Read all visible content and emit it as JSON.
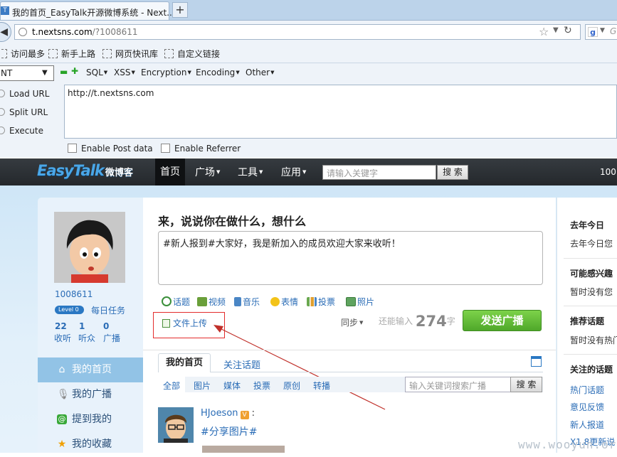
{
  "browser": {
    "tab_title": "我的首页_EasyTalk开源微博系统 - Next...",
    "new_tab_symbol": "+",
    "url_host": "t.nextsns.com",
    "url_rest": "/?1008611",
    "search_engine_hint": "G",
    "bookmarks": [
      "访问最多",
      "新手上路",
      "网页快讯库",
      "自定义链接"
    ]
  },
  "hackbar": {
    "select_value": "NT",
    "menus": [
      "SQL",
      "XSS",
      "Encryption",
      "Encoding",
      "Other"
    ],
    "actions": [
      "Load URL",
      "Split URL",
      "Execute"
    ],
    "url_value": "http://t.nextsns.com",
    "checkboxes": [
      "Enable Post data",
      "Enable Referrer"
    ]
  },
  "site": {
    "logo": "EasyTalk",
    "logo_sub": "微博客",
    "nav": [
      "首页",
      "广场",
      "工具",
      "应用"
    ],
    "search_placeholder": "请输入关键字",
    "search_button": "搜 索",
    "nav_right": "100",
    "profile": {
      "username": "1008611",
      "level": "Level 0",
      "daily_task": "每日任务",
      "stats": [
        {
          "num": "22",
          "label": "收听"
        },
        {
          "num": "1",
          "label": "听众"
        },
        {
          "num": "0",
          "label": "广播"
        }
      ]
    },
    "sidebar": [
      "我的首页",
      "我的广播",
      "提到我的",
      "我的收藏"
    ],
    "composer": {
      "title": "来，说说你在做什么，想什么",
      "text": "#新人报到#大家好，我是新加入的成员欢迎大家来收听！",
      "tools": [
        "话题",
        "视频",
        "音乐",
        "表情",
        "投票",
        "照片"
      ],
      "upload": "文件上传",
      "sync": "同步",
      "remaining_label": "还能输入",
      "remaining_count": "274",
      "remaining_unit": "字",
      "send": "发送广播"
    },
    "feed": {
      "tabs": [
        "我的首页",
        "关注话题"
      ],
      "filters": [
        "全部",
        "图片",
        "媒体",
        "投票",
        "原创",
        "转播"
      ],
      "search_placeholder": "输入关键词搜索广播",
      "search_button": "搜 索",
      "post_user": "HJoeson",
      "post_colon": ":",
      "post_text": "#分享图片#"
    },
    "right": {
      "today_title": "去年今日",
      "today_text": "去年今日您",
      "interest_title": "可能感兴趣",
      "interest_text": "暂时没有您",
      "recommend_title": "推荐话题",
      "recommend_text": "暂时没有热门",
      "follow_title": "关注的话题",
      "links": [
        "热门话题",
        "意见反馈",
        "新人报道",
        "X1.8更新说"
      ]
    }
  },
  "watermark": "www.wooyun.org",
  "colors": {
    "link": "#2a6cb6",
    "nav_bg": "#2e3236",
    "send_green": "#5cb833",
    "highlight_red": "#e32c2c"
  }
}
